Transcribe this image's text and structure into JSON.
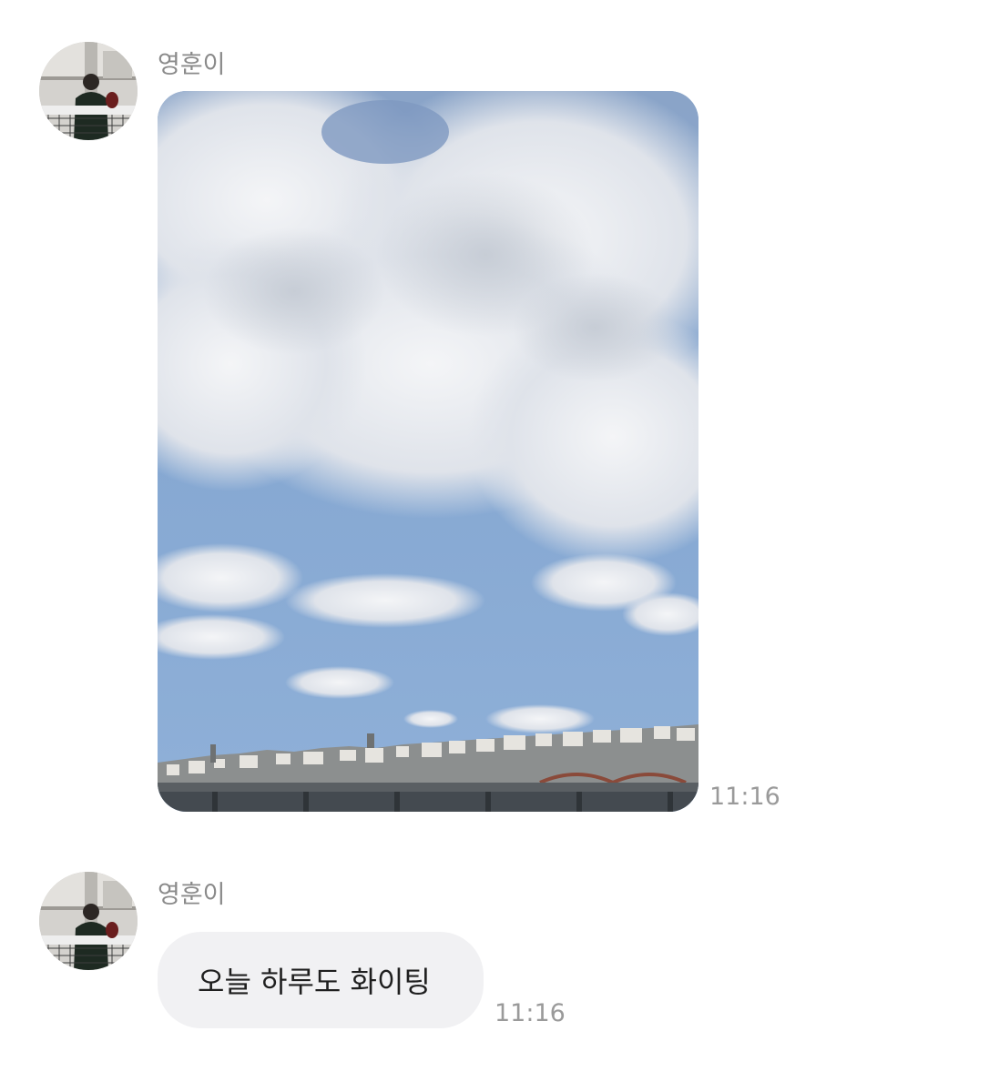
{
  "messages": [
    {
      "sender": "영훈이",
      "avatar_icon": "profile-photo",
      "type": "image",
      "image_description_icon": "sky-city-photo",
      "time": "11:16"
    },
    {
      "sender": "영훈이",
      "avatar_icon": "profile-photo",
      "type": "text",
      "text": "오늘 하루도 화이팅",
      "time": "11:16"
    }
  ],
  "colors": {
    "background": "#ffffff",
    "bubble": "#f1f1f3",
    "sender_text": "#8a8a8a",
    "time_text": "#9a9a9a",
    "message_text": "#1f1f1f"
  }
}
